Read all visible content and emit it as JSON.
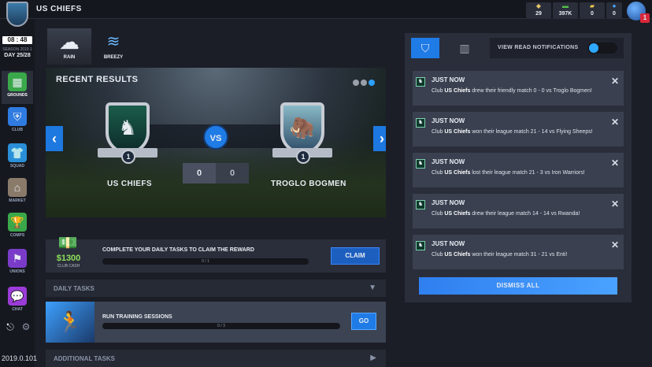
{
  "header": {
    "club_name": "US CHIEFS",
    "stats": [
      {
        "icon": "ball-icon",
        "value": "29"
      },
      {
        "icon": "cash-icon",
        "value": "397K"
      },
      {
        "icon": "ticket-icon",
        "value": "0"
      },
      {
        "icon": "drop-icon",
        "value": "0"
      }
    ],
    "notification_count": "1"
  },
  "sidebar": {
    "clock": "08 : 48 PM",
    "season": "SEASON 2019.1",
    "day": "DAY 25/28",
    "items": [
      {
        "label": "GROUNDS",
        "icon": "stadium-icon",
        "active": true
      },
      {
        "label": "CLUB",
        "icon": "club-icon"
      },
      {
        "label": "SQUAD",
        "icon": "jersey-icon"
      },
      {
        "label": "MARKET",
        "icon": "market-icon"
      },
      {
        "label": "COMPS",
        "icon": "trophy-icon"
      },
      {
        "label": "UNIONS",
        "icon": "unions-icon"
      },
      {
        "label": "CHAT",
        "icon": "chat-icon"
      }
    ],
    "version": "2019.0.101"
  },
  "weather": [
    {
      "label": "RAIN",
      "icon": "rain-cloud-icon"
    },
    {
      "label": "BREEZY",
      "icon": "wind-icon"
    }
  ],
  "results": {
    "title": "RECENT RESULTS",
    "vs": "VS",
    "home": {
      "name": "US CHIEFS",
      "score": "0",
      "tier": "1"
    },
    "away": {
      "name": "TROGLO BOGMEN",
      "score": "0",
      "tier": "1"
    }
  },
  "daily_reward": {
    "cash": "$1300",
    "cash_label": "CLUB CASH",
    "text": "COMPLETE YOUR DAILY TASKS TO CLAIM THE REWARD",
    "progress_text": "0 / 1",
    "progress": 0,
    "claim_label": "CLAIM"
  },
  "daily_tasks": {
    "title": "DAILY TASKS"
  },
  "training": {
    "text": "RUN TRAINING SESSIONS",
    "progress_text": "0 / 3",
    "progress": 0,
    "go_label": "GO"
  },
  "additional_tasks": {
    "title": "ADDITIONAL TASKS"
  },
  "notifications": {
    "view_read_label": "VIEW READ NOTIFICATIONS",
    "items": [
      {
        "title": "JUST NOW",
        "pre": "Club ",
        "club": "US Chiefs",
        "post": " drew their friendly match 0 - 0 vs Troglo Bogmen!"
      },
      {
        "title": "JUST NOW",
        "pre": "Club ",
        "club": "US Chiefs",
        "post": " won their league match 21 - 14 vs Flying Sheeps!"
      },
      {
        "title": "JUST NOW",
        "pre": "Club ",
        "club": "US Chiefs",
        "post": " lost their league match 21 - 3 vs Iron Warriors!"
      },
      {
        "title": "JUST NOW",
        "pre": "Club ",
        "club": "US Chiefs",
        "post": " drew their league match 14 - 14 vs Rwanda!"
      },
      {
        "title": "JUST NOW",
        "pre": "Club ",
        "club": "US Chiefs",
        "post": " won their league match 31 - 21 vs Enti!"
      }
    ],
    "dismiss_label": "DISMISS ALL"
  },
  "colors": {
    "accent": "#1f7be6",
    "cash": "#8ee05a",
    "badge": "#d8283a"
  }
}
